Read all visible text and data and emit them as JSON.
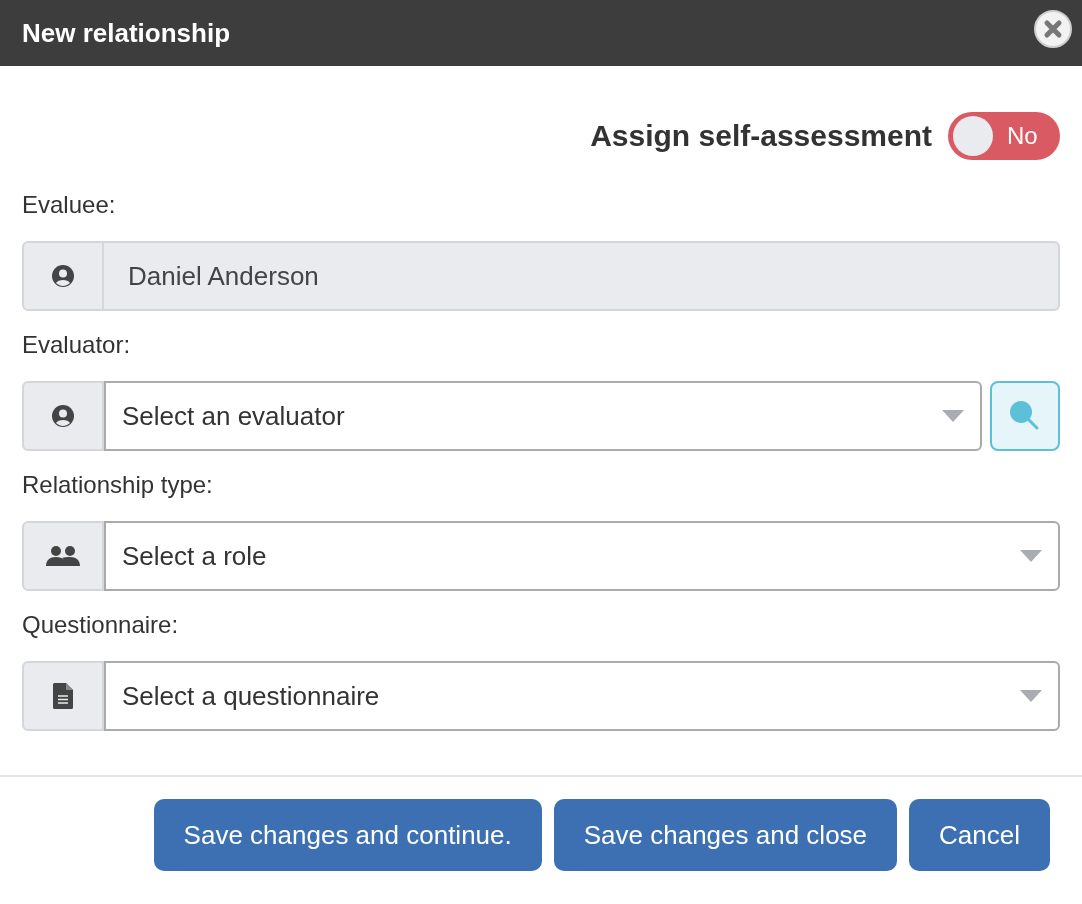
{
  "window": {
    "title": "New relationship"
  },
  "self_assessment": {
    "label": "Assign self-assessment",
    "on": false,
    "state_text": "No"
  },
  "fields": [
    {
      "label": "Evaluee:",
      "kind": "readonly",
      "value": "Daniel Anderson",
      "search_button": false
    },
    {
      "label": "Evaluator:",
      "kind": "select",
      "placeholder": "Select an evaluator",
      "search_button": true
    },
    {
      "label": "Relationship type:",
      "kind": "select",
      "placeholder": "Select a role",
      "search_button": false
    },
    {
      "label": "Questionnaire:",
      "kind": "select",
      "placeholder": "Select a questionnaire",
      "search_button": false
    }
  ],
  "buttons": [
    "Save changes and continue.",
    "Save changes and close",
    "Cancel"
  ]
}
